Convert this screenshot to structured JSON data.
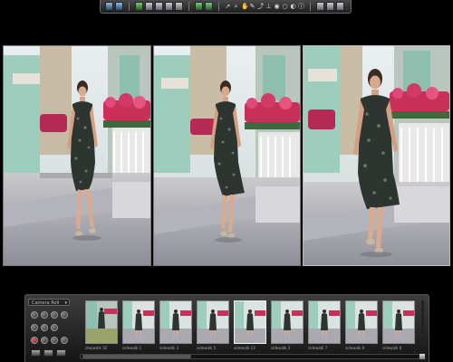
{
  "app": {
    "toolbar": {
      "icons": [
        "view-single-icon",
        "view-compare-icon",
        "import-icon",
        "export-icon",
        "folder-icon",
        "copy-icon",
        "stack-icon",
        "crop-icon",
        "rotate-left-icon",
        "rotate-right-icon",
        "pointer-icon",
        "zoom-icon",
        "hand-icon",
        "pen-icon",
        "lift-icon",
        "stamp-icon",
        "eye-icon",
        "loupe-icon",
        "adjust-icon",
        "info-icon",
        "grid-icon",
        "settings-icon"
      ]
    },
    "filmstrip": {
      "album_select": "Camera Roll",
      "thumbnails": [
        {
          "label": "stepwalk 32",
          "selected": false
        },
        {
          "label": "sidewalk 1",
          "selected": false
        },
        {
          "label": "sidewalk 3",
          "selected": false
        },
        {
          "label": "sidewalk 5",
          "selected": false
        },
        {
          "label": "sidewalk 13",
          "selected": true
        },
        {
          "label": "sidewalk 3",
          "selected": false
        },
        {
          "label": "sidewalk 7",
          "selected": false
        },
        {
          "label": "sidewalk 9",
          "selected": false
        },
        {
          "label": "sidewalk 8",
          "selected": false
        }
      ]
    },
    "colors": {
      "background": "#000000",
      "panel": "#2a2a2a",
      "flowers": "#c8305a",
      "building": "#8fc7b5"
    }
  }
}
